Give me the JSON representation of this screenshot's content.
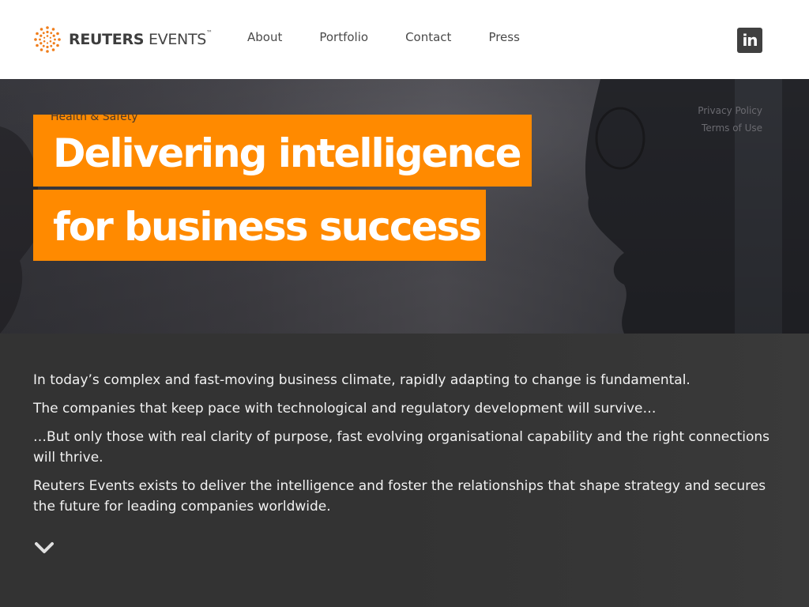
{
  "header": {
    "logo": {
      "brand_bold": "REUTERS",
      "brand_light": "EVENTS",
      "trademark": "™"
    },
    "nav": [
      {
        "label": "About"
      },
      {
        "label": "Portfolio"
      },
      {
        "label": "Contact"
      },
      {
        "label": "Press"
      }
    ],
    "social": {
      "linkedin_label": "in",
      "icon": "linkedin-icon"
    }
  },
  "hero": {
    "category": "Health & Safety",
    "headline_line1": "Delivering intelligence",
    "headline_line2": "for business success",
    "legal_links": [
      {
        "label": "Privacy Policy"
      },
      {
        "label": "Terms of Use"
      }
    ]
  },
  "content": {
    "paragraphs": [
      "In today’s complex and fast-moving business climate, rapidly adapting to change is fundamental.",
      "The companies that keep pace with technological and regulatory development will survive…",
      "…But only those with real clarity of purpose, fast evolving organisational capability and the right connections will thrive.",
      "Reuters Events exists to deliver the intelligence and foster the relationships that shape strategy and secures the future for leading companies worldwide."
    ],
    "scroll_icon": "chevron-down-icon"
  },
  "colors": {
    "accent": "#ff8a00",
    "header_bg": "#ffffff",
    "content_bg": "#333333",
    "text_light": "#f2f2f2",
    "nav_text": "#4a4a4a"
  }
}
